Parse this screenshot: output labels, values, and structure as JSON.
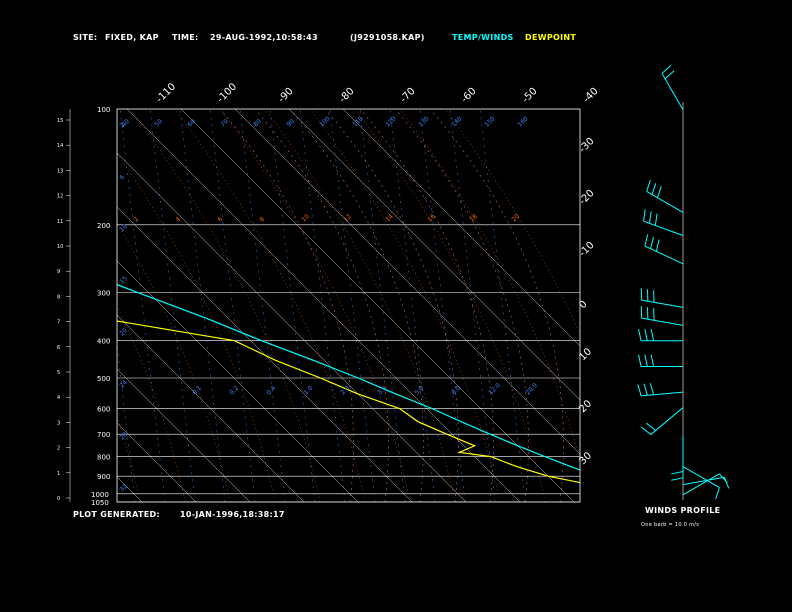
{
  "header": {
    "site_label": "SITE:",
    "site_value": "FIXED, KAP",
    "time_label": "TIME:",
    "time_value": "29-AUG-1992,10:58:43",
    "file_id": "(J9291058.KAP)",
    "legend_temp": "TEMP/WINDS",
    "legend_dew": "DEWPOINT"
  },
  "footer": {
    "generated_label": "PLOT GENERATED:",
    "generated_value": "10-JAN-1996,18:38:17",
    "winds_title": "WINDS PROFILE",
    "barb_note": "One barb = 10.0 m/s"
  },
  "colors": {
    "temp": "#00ffff",
    "dewpoint": "#ffff00",
    "frame": "#ffffff",
    "dry_adiabat": "#ff6600",
    "moist_adiabat": "#ff9999",
    "mixing_ratio": "#4488ff",
    "background": "#000000"
  },
  "chart_data": {
    "type": "line",
    "subtype": "skew-T log-P sounding",
    "pressure_levels": [
      100,
      200,
      300,
      400,
      500,
      600,
      700,
      800,
      900,
      1000,
      1050
    ],
    "pressure_tick_labels": [
      "100",
      "200",
      "300",
      "400",
      "500",
      "600",
      "700",
      "800",
      "900",
      "1000",
      "1050"
    ],
    "height_tick_labels": [
      "0",
      "1",
      "2",
      "3",
      "4",
      "5",
      "6",
      "7",
      "8",
      "9",
      "10",
      "11",
      "12",
      "13",
      "14",
      "15"
    ],
    "top_temp_labels": [
      "-110",
      "-100",
      "-90",
      "-80",
      "-70",
      "-60",
      "-50",
      "-40"
    ],
    "right_temp_labels": [
      "-30",
      "-20",
      "-10",
      "0",
      "10",
      "20",
      "30"
    ],
    "dry_adiabat_labels": [
      "2",
      "4",
      "6",
      "8",
      "10",
      "12",
      "14",
      "16",
      "18",
      "20"
    ],
    "theta_labels": [
      "2",
      "6",
      "10",
      "15",
      "20",
      "24",
      "28",
      "32"
    ],
    "mixing_labels": [
      "0.1",
      "0.2",
      "0.4",
      "1.0",
      "2.0",
      "3.5",
      "5.0",
      "8.0",
      "12.0",
      "20.0"
    ],
    "mixing_top_labels": [
      "40",
      "50",
      "60",
      "70",
      "80",
      "90",
      "100",
      "110",
      "120",
      "130",
      "140",
      "150",
      "160"
    ],
    "ylim_pressure": [
      1050,
      100
    ],
    "temperature": [
      [
        1040,
        30
      ],
      [
        1000,
        26
      ],
      [
        950,
        23
      ],
      [
        900,
        19
      ],
      [
        850,
        16
      ],
      [
        800,
        13
      ],
      [
        750,
        10
      ],
      [
        700,
        7
      ],
      [
        650,
        4
      ],
      [
        600,
        1
      ],
      [
        550,
        -3
      ],
      [
        500,
        -7
      ],
      [
        450,
        -12
      ],
      [
        400,
        -18
      ],
      [
        350,
        -24
      ],
      [
        300,
        -32
      ],
      [
        250,
        -41
      ],
      [
        200,
        -52
      ],
      [
        170,
        -58
      ],
      [
        150,
        -62
      ],
      [
        130,
        -66
      ]
    ],
    "dewpoint": [
      [
        1040,
        22
      ],
      [
        1000,
        19
      ],
      [
        960,
        18
      ],
      [
        900,
        10
      ],
      [
        850,
        6
      ],
      [
        800,
        3
      ],
      [
        780,
        -2
      ],
      [
        750,
        2
      ],
      [
        700,
        -1
      ],
      [
        650,
        -4
      ],
      [
        600,
        -5
      ],
      [
        550,
        -10
      ],
      [
        500,
        -14
      ],
      [
        450,
        -19
      ],
      [
        400,
        -23
      ],
      [
        370,
        -35
      ],
      [
        340,
        -48
      ],
      [
        320,
        -62
      ],
      [
        300,
        -70
      ],
      [
        285,
        -75
      ],
      [
        270,
        -72
      ],
      [
        250,
        -66
      ],
      [
        230,
        -66
      ],
      [
        210,
        -64
      ],
      [
        180,
        -67
      ],
      [
        150,
        -72
      ],
      [
        130,
        -76
      ]
    ],
    "wind_profile": {
      "title": "WINDS PROFILE",
      "levels": [
        15.2,
        11.2,
        10.3,
        9.2,
        7.5,
        6.8,
        6.2,
        5.2,
        4.2,
        3.6,
        2.5,
        1.3,
        0.6,
        0.2
      ],
      "directions": [
        330,
        300,
        290,
        295,
        280,
        280,
        270,
        270,
        265,
        230,
        180,
        120,
        80,
        60
      ],
      "speeds": [
        20,
        30,
        30,
        30,
        30,
        30,
        25,
        30,
        30,
        15,
        20,
        10,
        10,
        5
      ]
    }
  }
}
